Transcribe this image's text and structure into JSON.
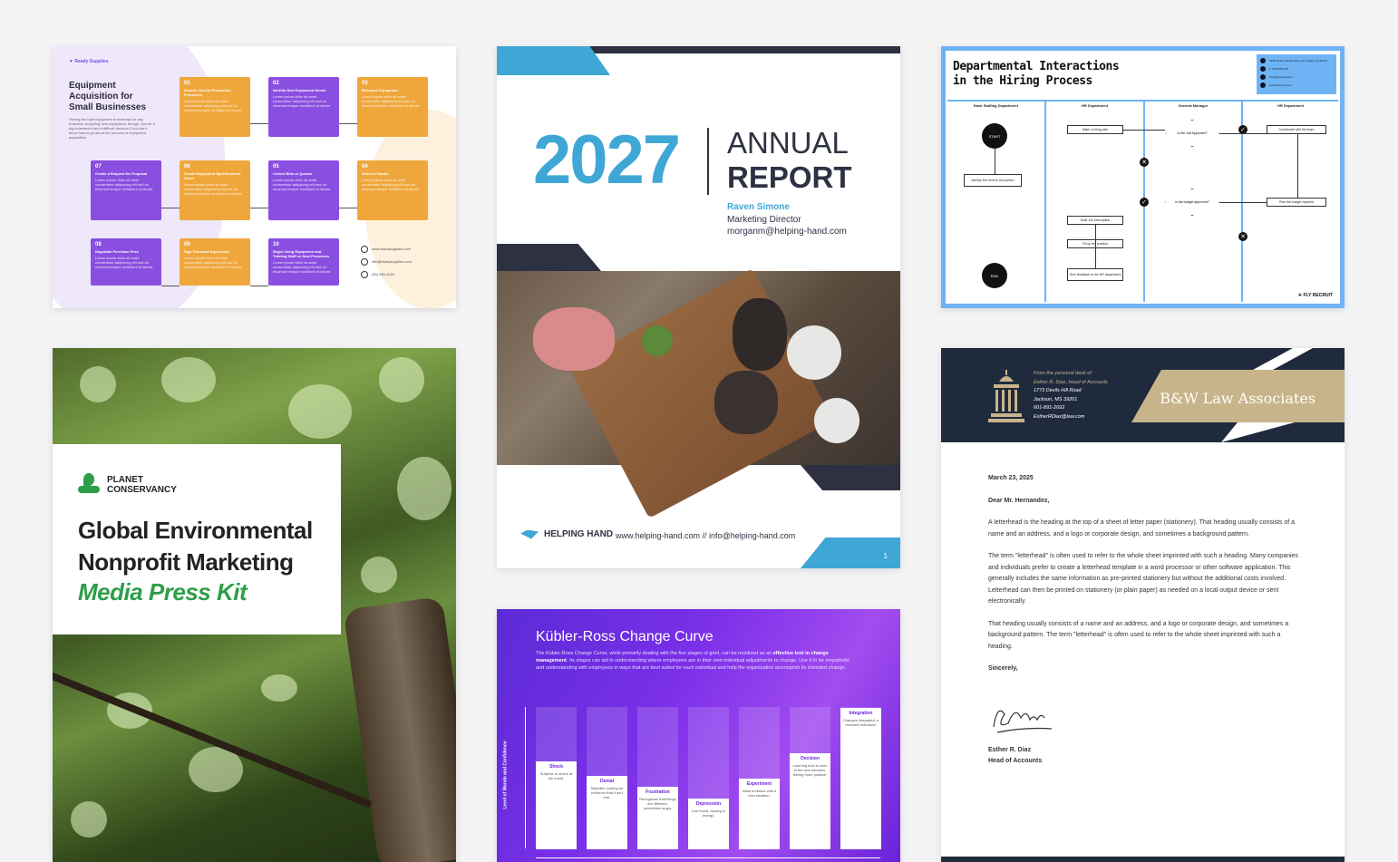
{
  "card1": {
    "brand": "Ready Supplies",
    "title": "Equipment Acquisition for Small Businesses",
    "desc": "Having the right equipment is essential for any business. Acquiring new equipment, though, can be a big investment and a difficult decision if you don't know how to go about the process of equipment acquisition.",
    "steps": [
      {
        "num": "01",
        "label": "Assess Current Production Processes"
      },
      {
        "num": "02",
        "label": "Identify New Equipment Needs"
      },
      {
        "num": "03",
        "label": "Research Equipment"
      },
      {
        "num": "04",
        "label": "Select a Vendor"
      },
      {
        "num": "05",
        "label": "Collect Bids or Quotes"
      },
      {
        "num": "06",
        "label": "Create Equipment Specifications Sheet"
      },
      {
        "num": "07",
        "label": "Create a Request for Proposal"
      },
      {
        "num": "08",
        "label": "Negotiate Purchase Price"
      },
      {
        "num": "09",
        "label": "Sign Purchase Agreement"
      },
      {
        "num": "10",
        "label": "Begin Using Equipment and Training Staff on New Processes"
      }
    ],
    "step_text": "Lorem ipsum dolor sit amet consectetur adipiscing elit sed do eiusmod tempor incididunt ut labore.",
    "contact": [
      "www.readysupplies.com",
      "info@readysupplies.com",
      "(55) 555-4220"
    ]
  },
  "card2": {
    "year": "2027",
    "annual": "ANNUAL",
    "report": "REPORT",
    "name": "Raven Simone",
    "role": "Marketing Director",
    "email": "morganm@helping-hand.com",
    "logo": "HELPING HAND",
    "web": "www.helping-hand.com  // info@helping-hand.com",
    "page": "1"
  },
  "card3": {
    "title_line1": "Departmental Interactions",
    "title_line2": "in the Hiring Process",
    "contact": [
      "2468 Hickory Ridge Drive Las Vegas, NV 89119",
      "1 702-555-0187",
      "info@flyrecruit.com",
      "www.flyrecruit.com"
    ],
    "lanes": [
      "Each Staffing Department",
      "HR Department",
      "General Manager",
      "HR Department"
    ],
    "start": "START",
    "end": "END",
    "boxes": {
      "identify": "Identify the need to fill position",
      "hiring_plan": "Make a hiring plan",
      "job_desc": "Draft Job Description",
      "fill_up": "Fill up the position",
      "feedback": "Give feedback to the HR department",
      "coordinate": "Coordinate with the team",
      "plan_budget": "Plan the budget required"
    },
    "decisions": {
      "approved": "Is the Job Approved?",
      "budget": "Is the budget approved?"
    },
    "brand": "FLY RECRUIT"
  },
  "card4": {
    "org_line1": "PLANET",
    "org_line2": "CONSERVANCY",
    "title_line1": "Global Environmental",
    "title_line2": "Nonprofit Marketing",
    "subtitle": "Media Press Kit"
  },
  "card5": {
    "title": "Kübler-Ross Change Curve",
    "desc_a": "The Kübler-Ross Change Curve, while primarily dealing with the five stages of grief, can be reutilized as an",
    "desc_b": "effective tool in change management",
    "desc_c": ". Its stages can aid in understanding where employees are in their own individual adjustments to change. Use it to be empathetic and understanding with employees in ways that are best suited for each individual and help the organization accomplish its intended change.",
    "ylabel": "Level of Morale and Confidence",
    "stages": [
      {
        "name": "Shock",
        "text": "Surprise or shock at the event.",
        "level": 0.62
      },
      {
        "name": "Denial",
        "text": "Disbelief, looking for evidence that it isn't true.",
        "level": 0.52
      },
      {
        "name": "Frustration",
        "text": "Recognizes that things are different, sometimes angry.",
        "level": 0.44
      },
      {
        "name": "Depression",
        "text": "Low mood, lacking in energy.",
        "level": 0.36
      },
      {
        "name": "Experiment",
        "text": "Initial embrace with a new situation.",
        "level": 0.5
      },
      {
        "name": "Decision",
        "text": "Learning how to work in the new situation, feeling more positive.",
        "level": 0.68
      },
      {
        "name": "Integration",
        "text": "Changes integrated, a renewed individual.",
        "level": 1.0
      }
    ]
  },
  "card6": {
    "firm": "B&W Law Associates",
    "addr_intro": "From the personal desk of",
    "addr_name": "Esther R. Diaz, Head of Accounts",
    "addr_street": "1773 Devils Hill Road",
    "addr_city": "Jackson, MS 39201",
    "addr_phone": "601-891-2692",
    "addr_email": "EstherRDiaz@law.com",
    "date": "March 23, 2025",
    "greeting": "Dear Mr. Hernandez,",
    "p1": "A letterhead is the heading at the top of a sheet of letter paper (stationery). That heading usually consists of a name and an address, and a logo or corporate design, and sometimes a background pattern.",
    "p2": "The term \"letterhead\" is often used to refer to the whole sheet imprinted with such a heading. Many companies and individuals prefer to create a letterhead template in a word processor or other software application. This generally includes the same information as pre-printed stationery but without the additional costs involved. Letterhead can then be printed on stationery (or plain paper) as needed on a local output device or sent electronically.",
    "p3": "That heading usually consists of a name and an address, and a logo or corporate design, and sometimes a background pattern. The term \"letterhead\" is often used to refer to the whole sheet imprinted with such a heading.",
    "closing": "Sincerely,",
    "sign_name": "Esther R. Diaz",
    "sign_title": "Head of Accounts"
  }
}
